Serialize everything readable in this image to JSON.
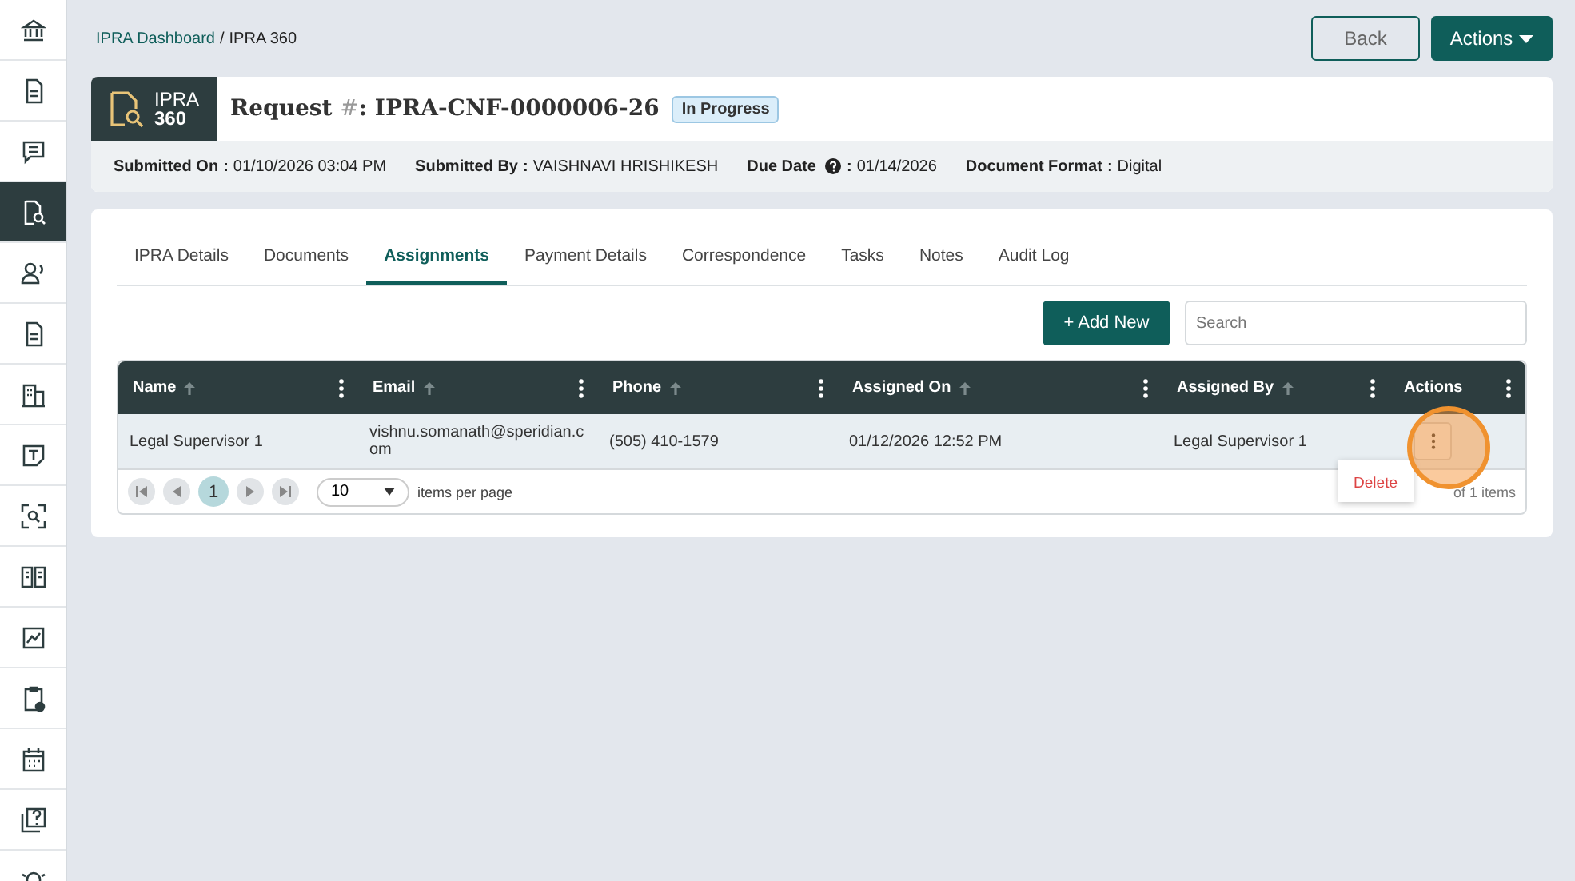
{
  "sidebar": {
    "items": [
      {
        "selected": false
      },
      {
        "selected": false
      },
      {
        "selected": false
      },
      {
        "selected": true
      },
      {
        "selected": false
      },
      {
        "selected": false
      },
      {
        "selected": false
      },
      {
        "selected": false
      },
      {
        "selected": false
      },
      {
        "selected": false
      },
      {
        "selected": false
      },
      {
        "selected": false
      },
      {
        "selected": false
      },
      {
        "selected": false
      },
      {
        "selected": false
      }
    ]
  },
  "breadcrumb": {
    "link": "IPRA Dashboard",
    "separator": "/",
    "current": "IPRA 360"
  },
  "header_buttons": {
    "back": "Back",
    "actions": "Actions"
  },
  "logo": {
    "line1": "IPRA",
    "line2": "360"
  },
  "request": {
    "label": "Request",
    "hash": "#",
    "separator": ":",
    "number": "IPRA-CNF-0000006-26",
    "status": "In Progress"
  },
  "info": [
    {
      "kind": "plain",
      "label": "Submitted On",
      "separator": ":",
      "value": "01/10/2026 03:04 PM"
    },
    {
      "kind": "plain",
      "label": "Submitted By",
      "separator": ":",
      "value": "VAISHNAVI HRISHIKESH"
    },
    {
      "kind": "help",
      "label": "Due Date",
      "separator": ":",
      "value": "01/14/2026"
    },
    {
      "kind": "plain",
      "label": "Document Format",
      "separator": ":",
      "value": "Digital"
    }
  ],
  "tabs": [
    {
      "label": "IPRA Details",
      "selected": false
    },
    {
      "label": "Documents",
      "selected": false
    },
    {
      "label": "Assignments",
      "selected": true
    },
    {
      "label": "Payment Details",
      "selected": false
    },
    {
      "label": "Correspondence",
      "selected": false
    },
    {
      "label": "Tasks",
      "selected": false
    },
    {
      "label": "Notes",
      "selected": false
    },
    {
      "label": "Audit Log",
      "selected": false
    }
  ],
  "add_button": "+ Add New",
  "search": {
    "placeholder": "Search"
  },
  "table": {
    "columns": [
      {
        "label": "Name",
        "sortable": true
      },
      {
        "label": "Email",
        "sortable": true
      },
      {
        "label": "Phone",
        "sortable": true
      },
      {
        "label": "Assigned On",
        "sortable": true
      },
      {
        "label": "Assigned By",
        "sortable": true
      },
      {
        "label": "Actions",
        "sortable": false
      }
    ],
    "rows": [
      {
        "cells": [
          "Legal Supervisor 1",
          "vishnu.somanath@speridian.com",
          "(505) 410-1579",
          "01/12/2026 12:52 PM",
          "Legal Supervisor 1"
        ]
      }
    ]
  },
  "pager": {
    "page": "1",
    "page_size": "10",
    "per_page_label": "items per page",
    "info": "of 1 items"
  },
  "row_menu": {
    "items": [
      "Delete"
    ]
  }
}
